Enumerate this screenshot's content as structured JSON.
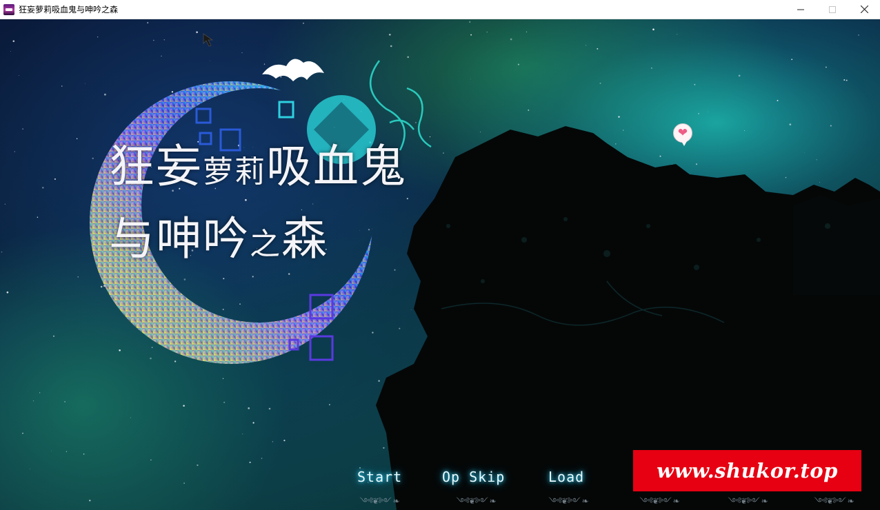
{
  "window": {
    "title": "狂妄萝莉吸血鬼与呻吟之森",
    "icon": "app-icon",
    "controls": {
      "minimize": "minimize-icon",
      "maximize": "maximize-icon",
      "close": "close-icon"
    }
  },
  "game": {
    "title_line1": {
      "big1": "狂妄",
      "small1": "萝莉",
      "big2": "吸血鬼"
    },
    "title_line2": {
      "big1": "与呻吟",
      "small1": "之",
      "big2": "森"
    }
  },
  "menu": {
    "items": [
      {
        "label": "Start"
      },
      {
        "label": "Op Skip"
      },
      {
        "label": "Load"
      }
    ],
    "ornament": "༺❦༻ ❧ ༺❦༻"
  },
  "watermark": {
    "text": "www.shukor.top"
  },
  "colors": {
    "menu_glow": "#35d8ff",
    "watermark_bg": "#e60012",
    "heart": "#ee5c86"
  }
}
